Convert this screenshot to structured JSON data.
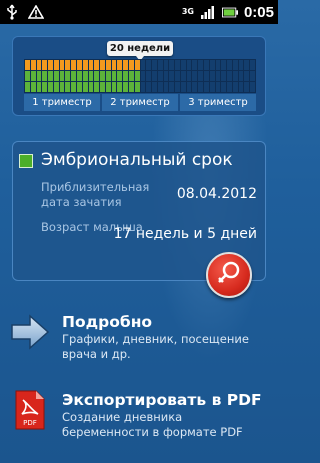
{
  "status_bar": {
    "network": "3G",
    "time": "0:05"
  },
  "progress": {
    "week_tag": "20 недели",
    "weeks_total": 40,
    "weeks_elapsed": 20,
    "trimesters": [
      "1 триместр",
      "2 триместр",
      "3 триместр"
    ]
  },
  "info": {
    "title": "Эмбриональный срок",
    "due_label": "Приблизительная дата зачатия",
    "due_value": "08.04.2012",
    "age_label": "Возраст малыша",
    "age_value": "17 недель и 5 дней"
  },
  "menu": {
    "details_title": "Подробно",
    "details_desc": "Графики, дневник, посещение врача и др.",
    "export_title": "Экспортировать в PDF",
    "export_desc": "Создание дневника беременности в формате PDF",
    "pdf_icon_label": "PDF"
  },
  "colors": {
    "accent_orange": "#f39a1e",
    "accent_green": "#5db33a",
    "background": "#1f5f9c"
  }
}
